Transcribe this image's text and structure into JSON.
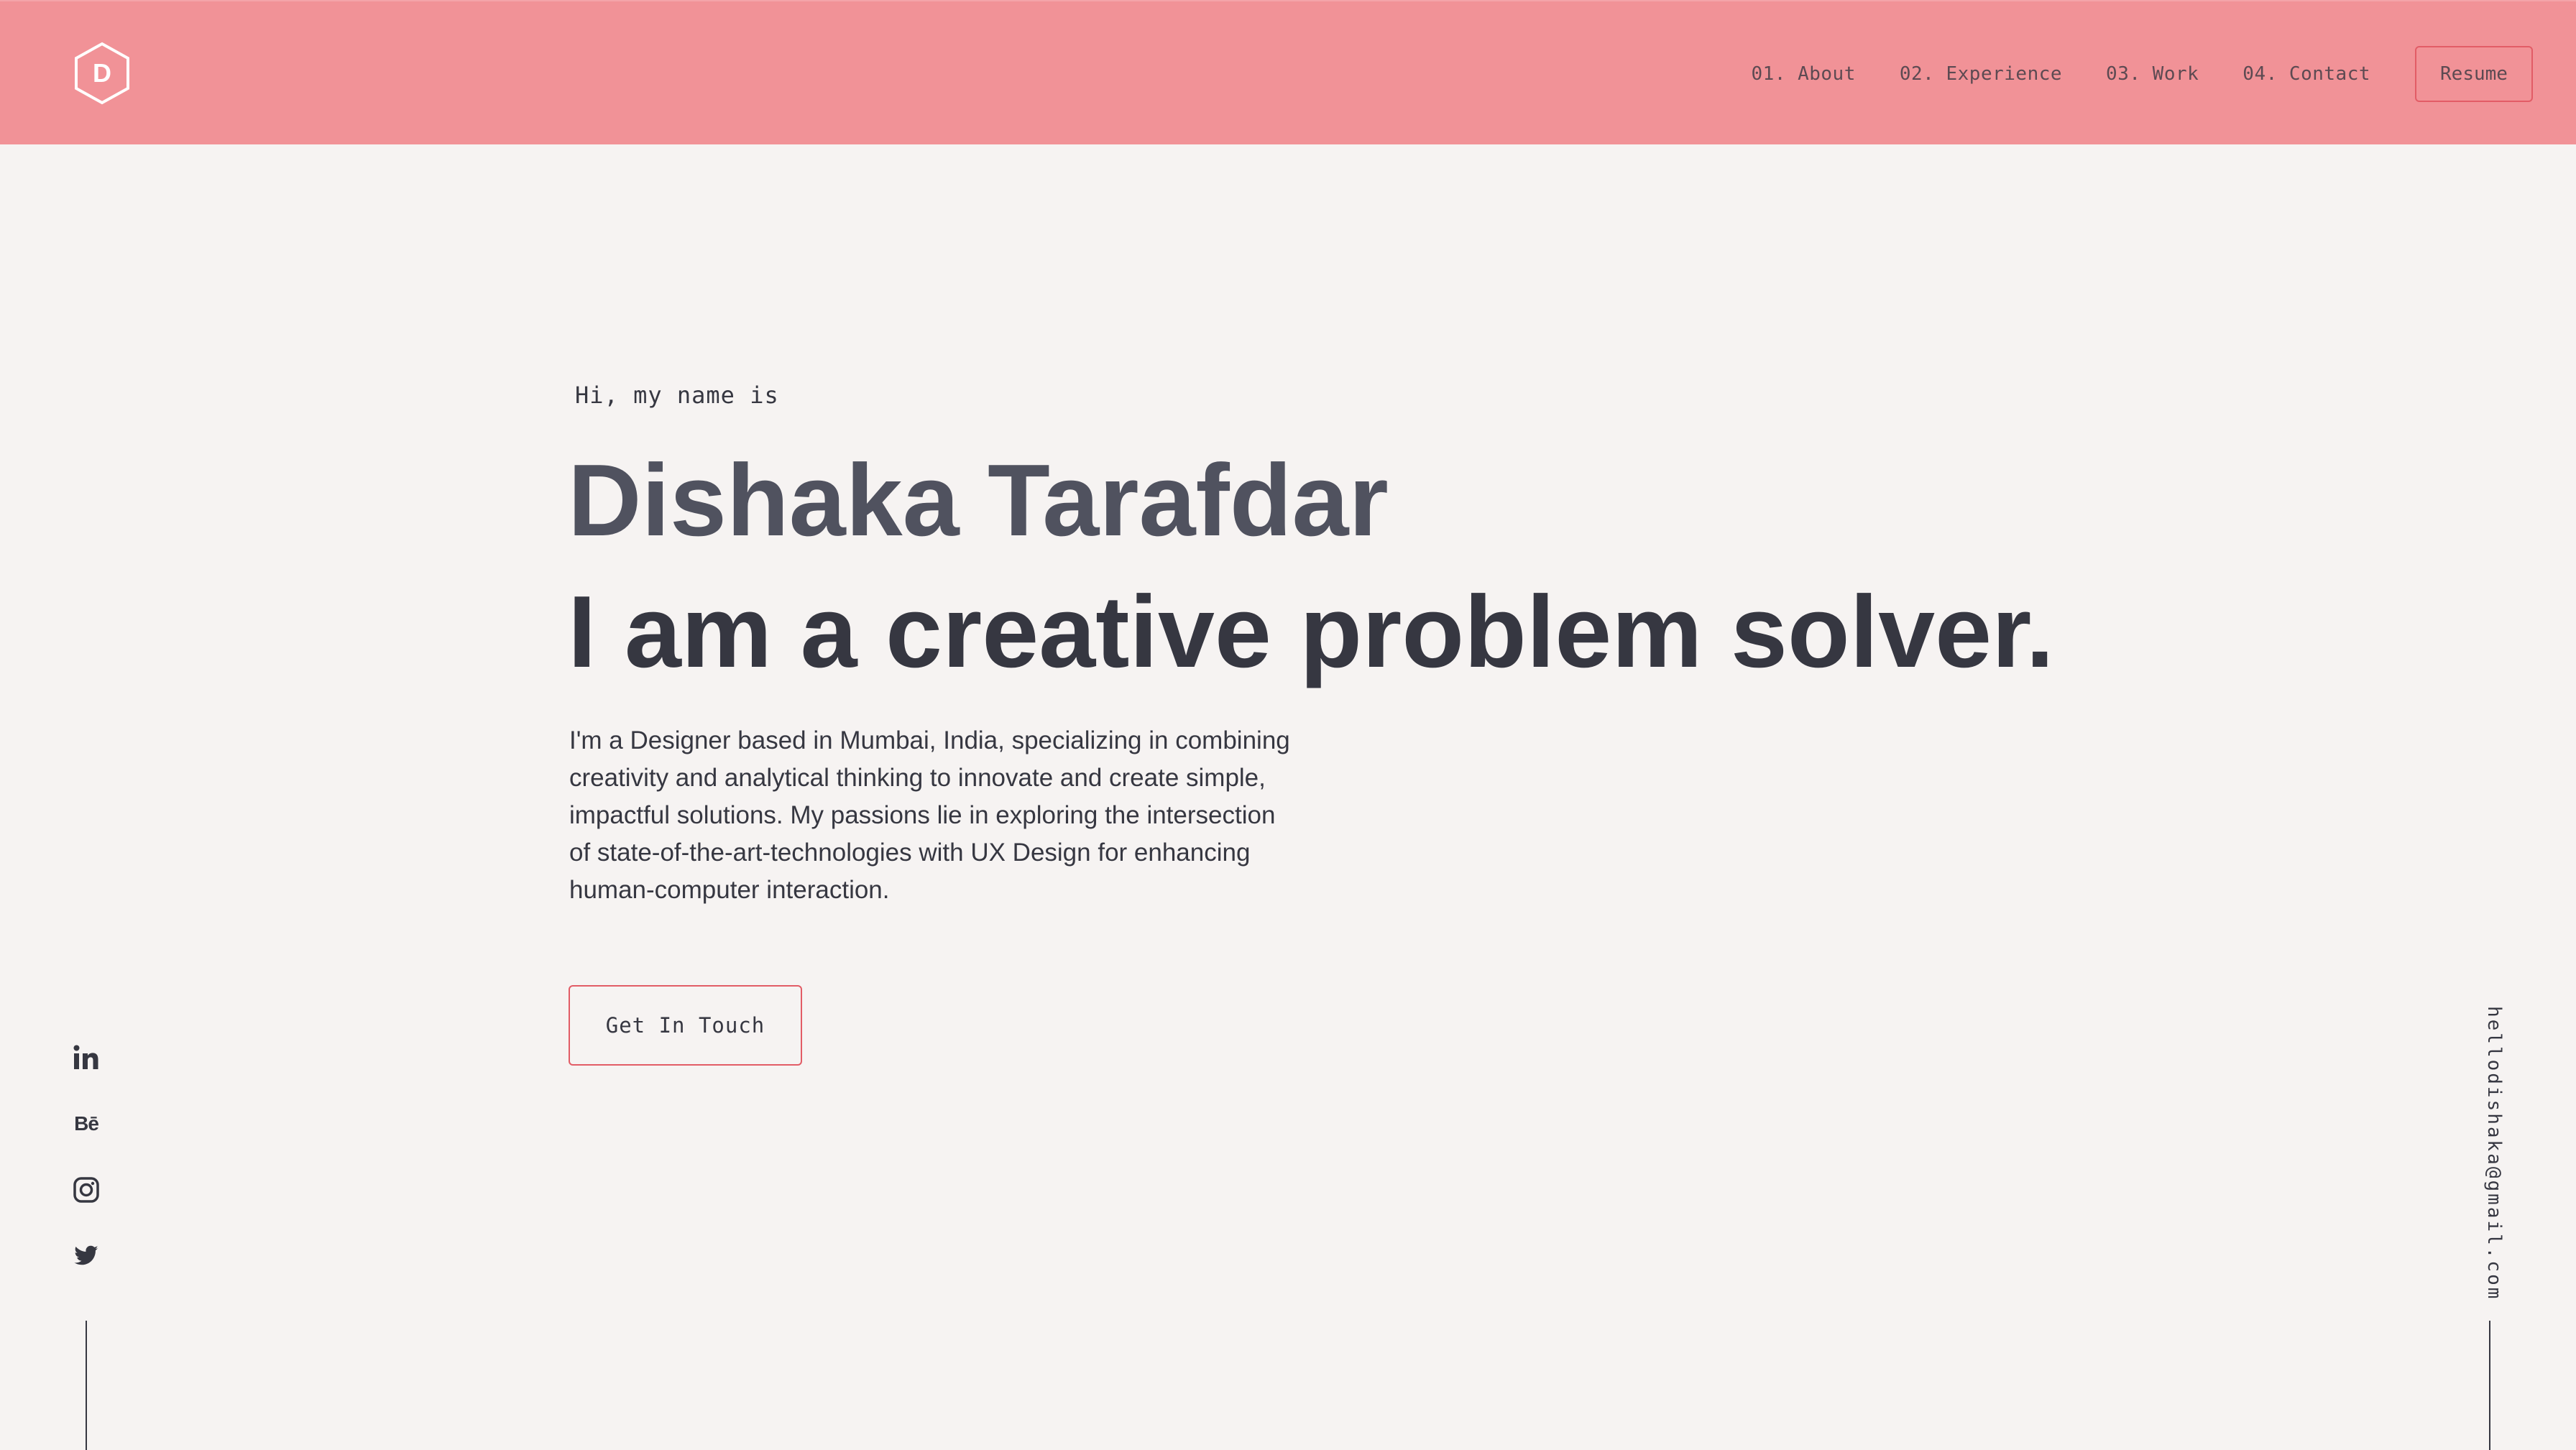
{
  "header": {
    "logo_letter": "D",
    "nav": [
      {
        "num": "01.",
        "label": "About"
      },
      {
        "num": "02.",
        "label": "Experience"
      },
      {
        "num": "03.",
        "label": "Work"
      },
      {
        "num": "04.",
        "label": "Contact"
      }
    ],
    "resume_label": "Resume"
  },
  "hero": {
    "greeting": "Hi, my name is",
    "name": "Dishaka Tarafdar",
    "tagline": "I am a creative problem solver.",
    "bio": "I'm a Designer based in Mumbai, India, specializing in combining creativity and analytical thinking to innovate and create simple, impactful solutions. My passions lie in exploring the intersection of state-of-the-art-technologies with UX Design for enhancing human-computer interaction.",
    "cta_label": "Get In Touch"
  },
  "social": {
    "items": [
      "linkedin-icon",
      "behance-icon",
      "instagram-icon",
      "twitter-icon"
    ],
    "behance_text": "Bē"
  },
  "email": "hellodishaka@gmail.com",
  "colors": {
    "header_bg": "#f19297",
    "page_bg": "#f6f3f2",
    "accent_border": "#e25c66",
    "text_dark": "#363741",
    "name_color": "#50525f"
  }
}
